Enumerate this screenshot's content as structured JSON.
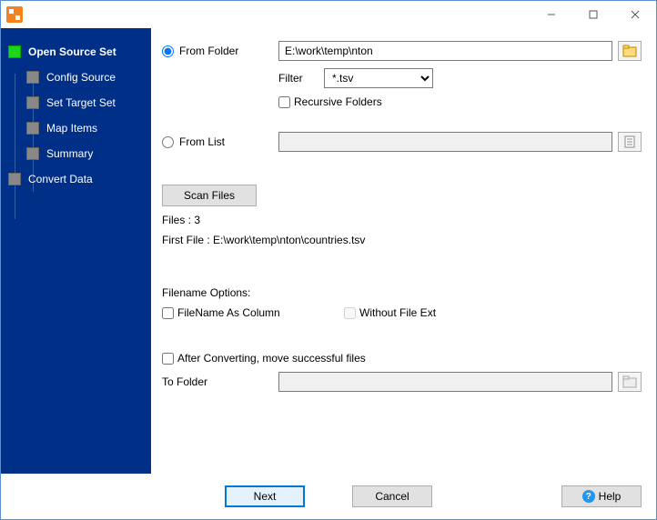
{
  "sidebar": {
    "items": [
      {
        "label": "Open Source Set"
      },
      {
        "label": "Config Source"
      },
      {
        "label": "Set Target Set"
      },
      {
        "label": "Map Items"
      },
      {
        "label": "Summary"
      },
      {
        "label": "Convert Data"
      }
    ]
  },
  "source": {
    "from_folder_label": "From Folder",
    "folder_path": "E:\\work\\temp\\nton",
    "filter_label": "Filter",
    "filter_value": "*.tsv",
    "recursive_label": "Recursive Folders",
    "from_list_label": "From List",
    "list_path": ""
  },
  "scan": {
    "button": "Scan Files",
    "files_label": "Files : 3",
    "first_file_label": "First File : E:\\work\\temp\\nton\\countries.tsv"
  },
  "filename_options": {
    "heading": "Filename Options:",
    "as_column_label": "FileName As Column",
    "without_ext_label": "Without File Ext"
  },
  "after": {
    "move_label": "After Converting, move successful files",
    "to_folder_label": "To Folder",
    "to_folder_path": ""
  },
  "footer": {
    "next": "Next",
    "cancel": "Cancel",
    "help": "Help"
  }
}
